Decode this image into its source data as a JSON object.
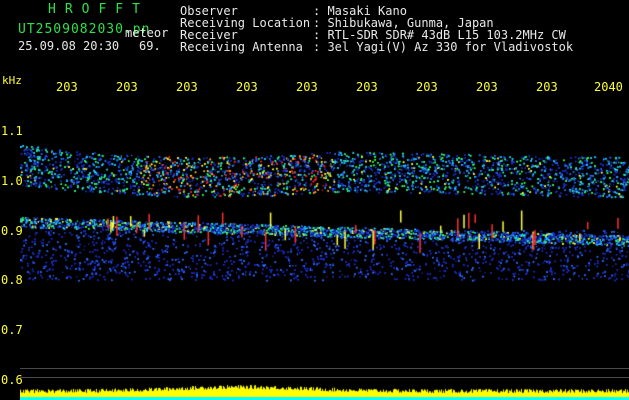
{
  "program": {
    "title": "HROFFT",
    "filename": "UT2509082030.pn",
    "datetime": "25.09.08 20:30",
    "mode_label": "meteor",
    "count": "69."
  },
  "info": {
    "labels": [
      "Observer",
      "Receiving Location",
      "Receiver",
      "Receiving Antenna"
    ],
    "values": [
      ": Masaki Kano",
      ": Shibukawa, Gunma, Japan",
      ": RTL-SDR SDR# 43dB L15 103.2MHz CW",
      ": 3el Yagi(V) Az 330 for Vladivostok"
    ]
  },
  "time_axis": {
    "ticks": [
      "203",
      "203",
      "203",
      "203",
      "203",
      "203",
      "203",
      "203",
      "203",
      "2040"
    ]
  },
  "freq_axis": {
    "unit": "kHz",
    "ticks": [
      "1.1",
      "1.0",
      "0.9",
      "0.8",
      "0.7",
      "0.6"
    ]
  },
  "colors": {
    "background": "#000000",
    "title": "#2ee04a",
    "text": "#e8e8e8",
    "axis": "#ffff33",
    "signal_low": "#1a2cff",
    "signal_high": "#ff2020",
    "strip": "#ffff00",
    "strip_base": "#00ffff"
  }
}
